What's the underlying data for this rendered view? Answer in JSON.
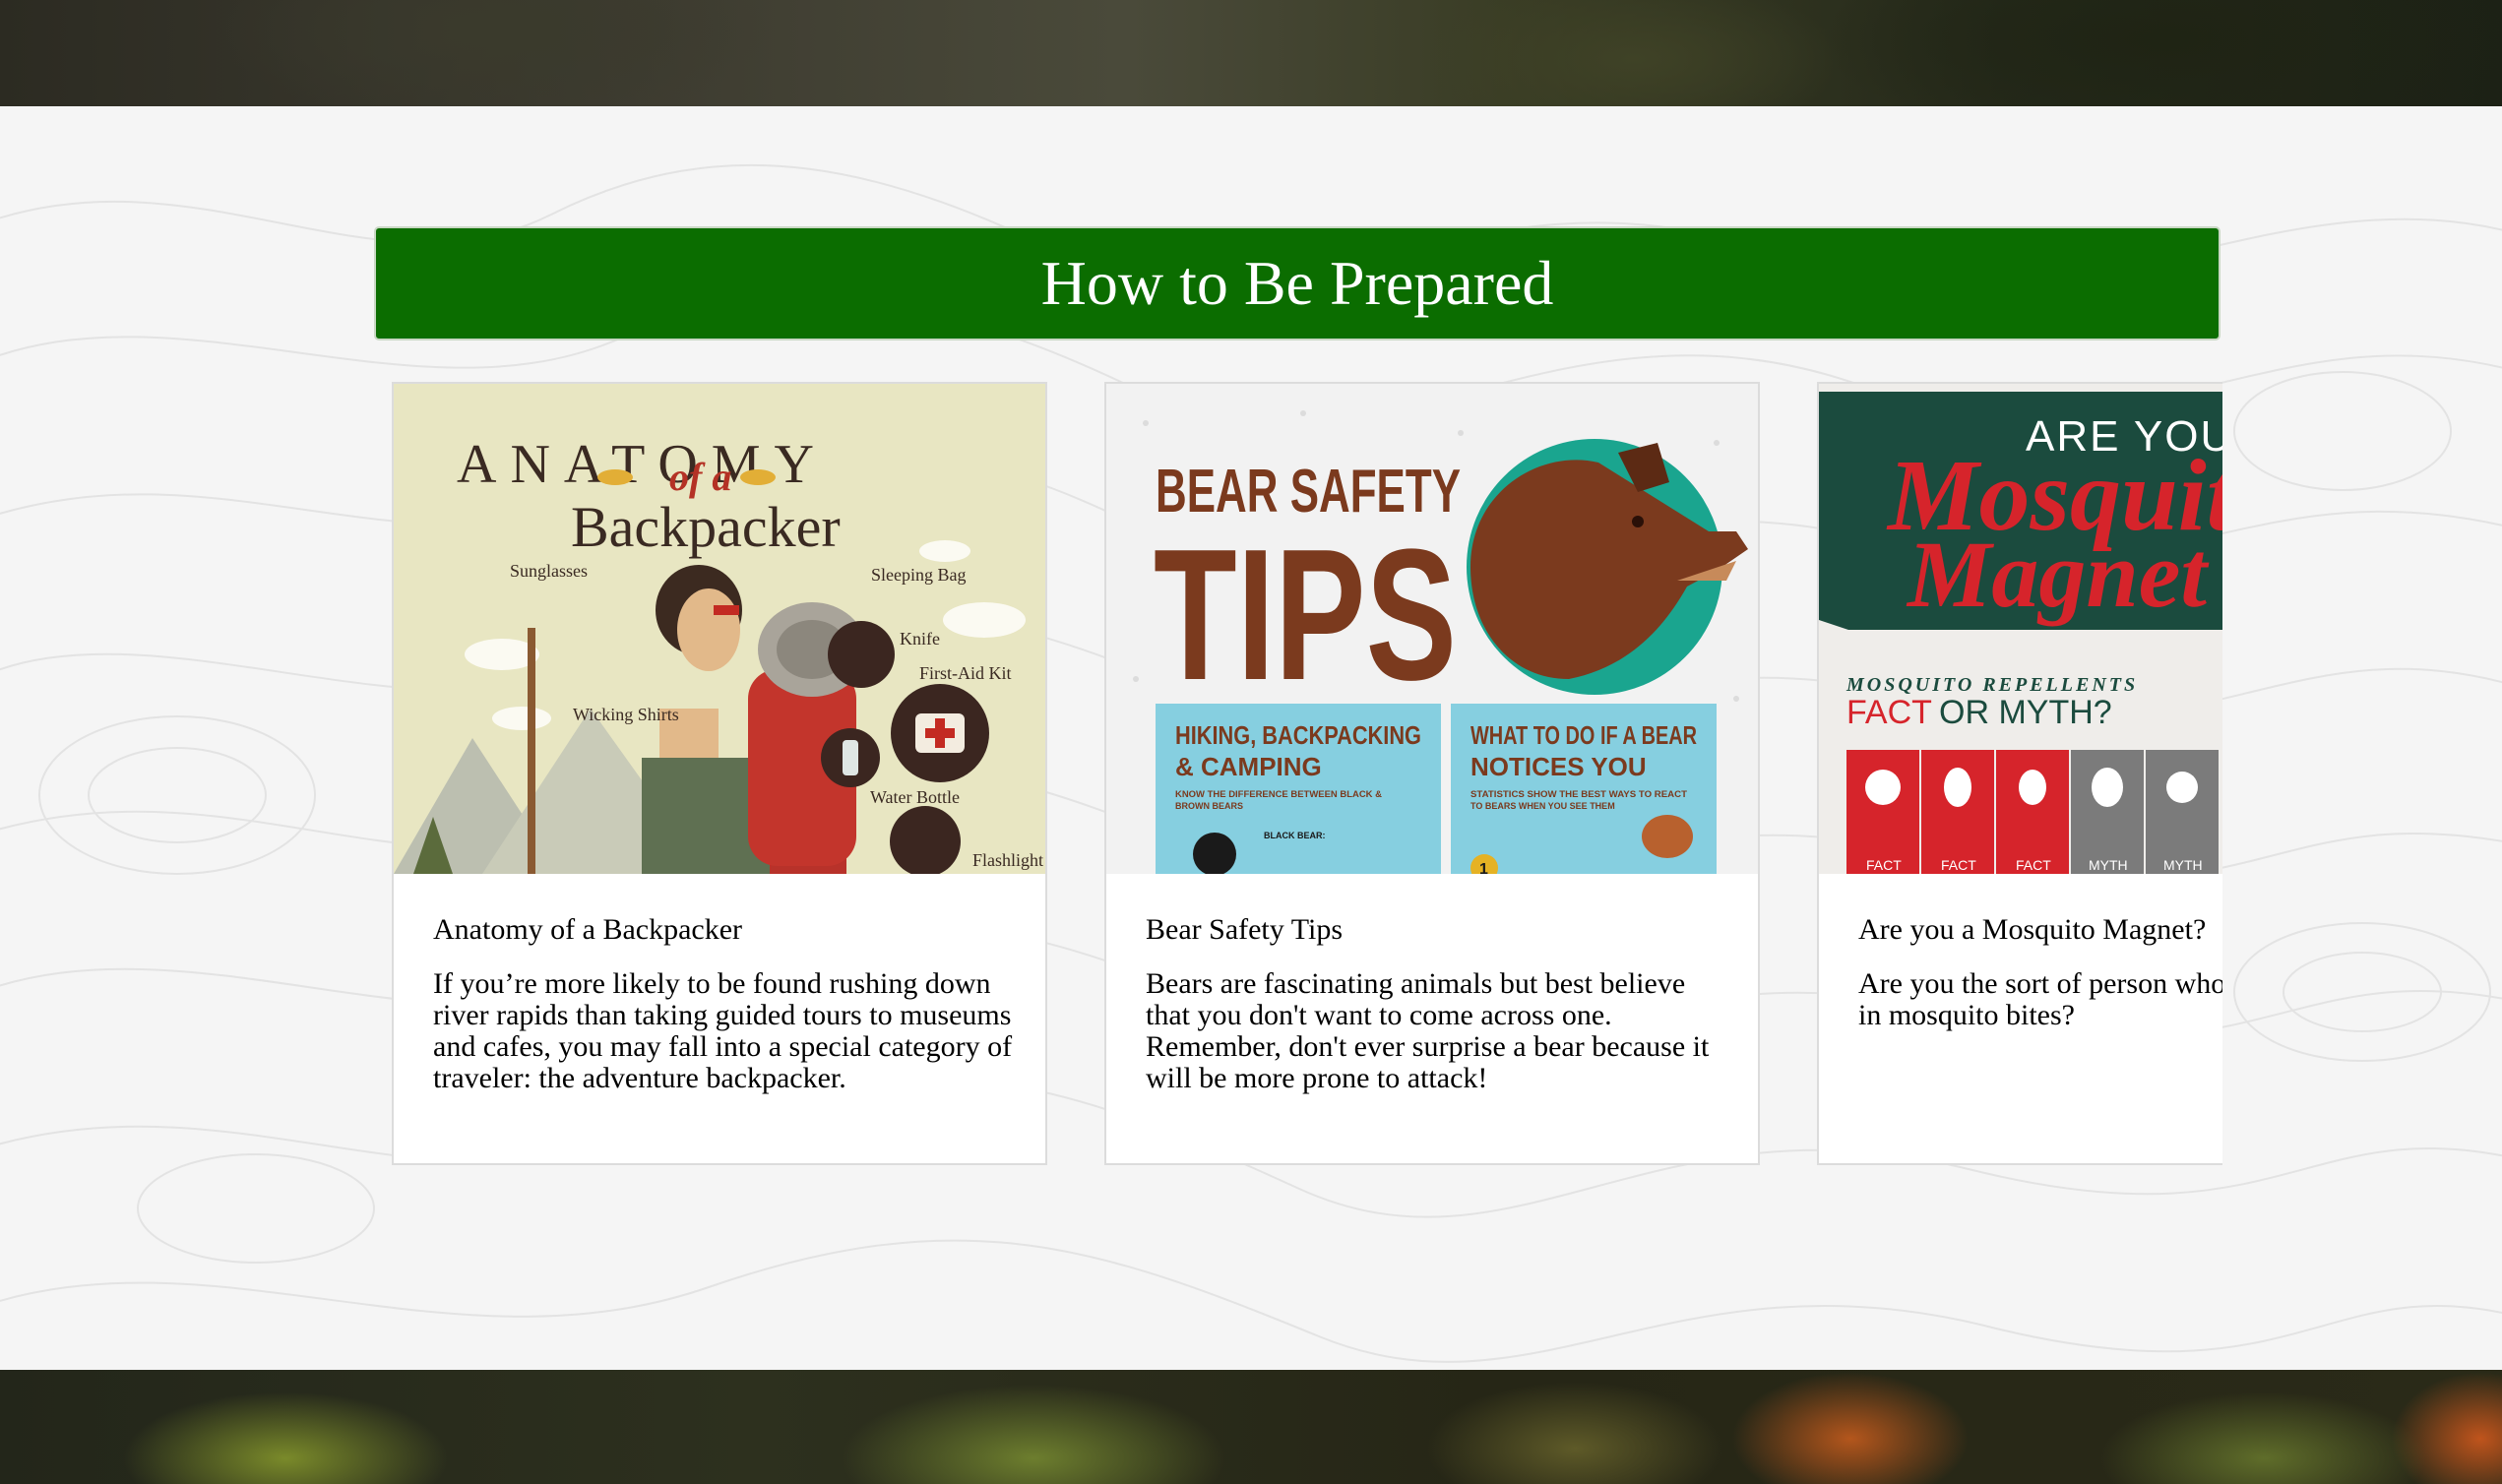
{
  "section": {
    "title": "How to Be Prepared"
  },
  "cards": [
    {
      "title": "Anatomy of a Backpacker",
      "text": "If you’re more likely to be found rushing down river rapids than taking guided tours to museums and cafes, you may fall into a special category of traveler: the adventure backpacker.",
      "image": {
        "heading_1": "ANATOMY",
        "heading_2": "of a",
        "heading_3": "Backpacker",
        "labels": [
          "Sunglasses",
          "Sleeping Bag",
          "Knife",
          "First-Aid Kit",
          "Wicking Shirts",
          "Water Bottle",
          "Flashlight"
        ]
      }
    },
    {
      "title": "Bear Safety Tips",
      "text": "Bears are fascinating animals but best believe that you don't want to come across one. Remember, don't ever surprise a bear because it will be more prone to attack!",
      "image": {
        "heading_1": "BEAR SAFETY",
        "heading_2": "TIPS",
        "panel_1_title_1": "HIKING, BACKPACKING",
        "panel_1_title_2": "& CAMPING",
        "panel_1_sub_1": "KNOW THE DIFFERENCE BETWEEN BLACK &",
        "panel_1_sub_2": "BROWN BEARS",
        "panel_1_note": "BLACK BEAR:",
        "panel_2_title_1": "WHAT TO DO IF A BEAR",
        "panel_2_title_2": "NOTICES YOU",
        "panel_2_sub_1": "STATISTICS SHOW THE BEST WAYS TO REACT",
        "panel_2_sub_2": "TO BEARS WHEN YOU SEE THEM",
        "panel_2_step": "1"
      }
    },
    {
      "title": "Are you a Mosquito Magnet?",
      "text": "Are you the sort of person who is always covered in mosquito bites?",
      "image": {
        "heading_1": "ARE YOU A",
        "heading_2": "Mosquito",
        "heading_3": "Magnet",
        "sub_heading": "MOSQUITO REPELLENTS",
        "fact_label": "FACT",
        "or_myth_label": "OR MYTH?",
        "columns": [
          "FACT",
          "FACT",
          "FACT",
          "MYTH",
          "MYTH"
        ]
      }
    }
  ],
  "colors": {
    "banner_green": "#0b6d00",
    "bear_brown": "#7b3a1e",
    "bear_teal": "#1aa58f",
    "mosquito_green": "#1b4b3e",
    "mosquito_red": "#d6242b"
  }
}
